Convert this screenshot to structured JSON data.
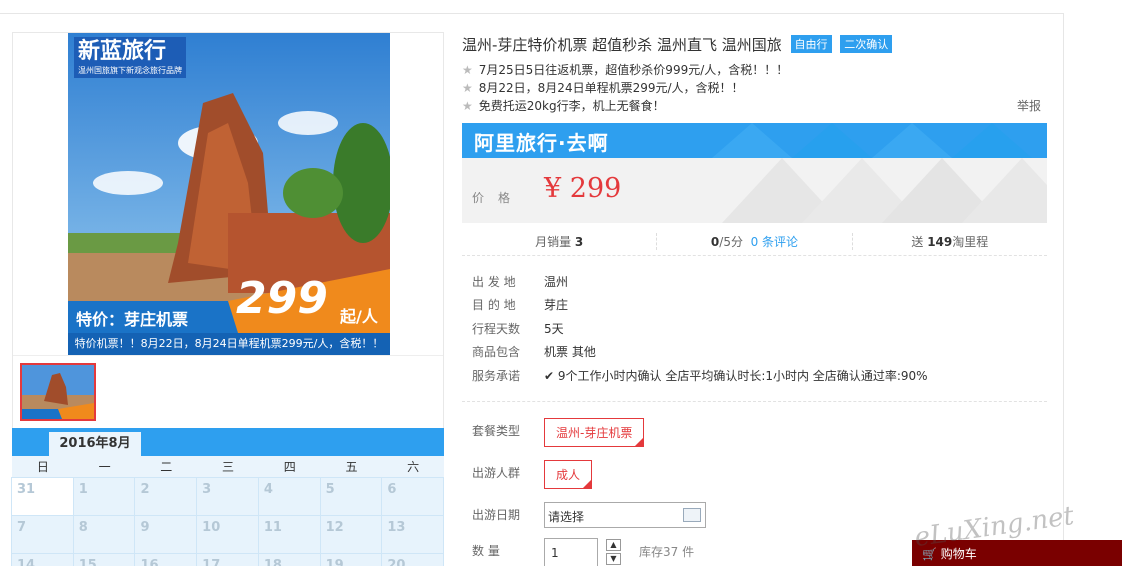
{
  "product": {
    "title": "温州-芽庄特价机票 超值秒杀 温州直飞 温州国旅",
    "tags": [
      "自由行",
      "二次确认"
    ],
    "features": [
      "7月25日5日往返机票，超值秒杀价999元/人，含税！！！",
      "8月22日，8月24日单程机票299元/人，含税！！",
      "免费托运20kg行李，机上无餐食！"
    ],
    "report_label": "举报"
  },
  "image": {
    "logo_text": "新蓝旅行",
    "logo_sub": "温州国旅旗下新观念旅行品牌",
    "promo_label": "特价：芽庄机票",
    "promo_price": "299",
    "promo_unit": "起/人",
    "caption": "特价机票！！8月22日，8月24日单程机票299元/人，含税！！"
  },
  "banner": {
    "brand": "阿里旅行·去啊",
    "price_label": "价格",
    "price": "¥ 299"
  },
  "stats": {
    "monthly_sales_label": "月销量",
    "monthly_sales": "3",
    "rating": "0",
    "rating_suffix": "/5分",
    "reviews": "0 条评论",
    "points_prefix": "送",
    "points": "149",
    "points_suffix": "淘里程"
  },
  "info": [
    {
      "label": "出 发 地",
      "value": "温州"
    },
    {
      "label": "目 的 地",
      "value": "芽庄"
    },
    {
      "label": "行程天数",
      "value": "5天"
    },
    {
      "label": "商品包含",
      "value": "机票  其他"
    },
    {
      "label": "服务承诺",
      "value": "✔ 9个工作小时内确认    全店平均确认时长:1小时内    全店确认通过率:90%"
    }
  ],
  "options": {
    "package_label": "套餐类型",
    "package_value": "温州-芽庄机票",
    "people_label": "出游人群",
    "people_value": "成人",
    "date_label": "出游日期",
    "date_placeholder": "请选择",
    "qty_label": "数   量",
    "qty_value": "1",
    "stock": "库存37 件"
  },
  "calendar": {
    "month": "2016年8月",
    "weekdays": [
      "日",
      "一",
      "二",
      "三",
      "四",
      "五",
      "六"
    ],
    "rows": [
      [
        "31",
        "1",
        "2",
        "3",
        "4",
        "5",
        "6"
      ],
      [
        "7",
        "8",
        "9",
        "10",
        "11",
        "12",
        "13"
      ],
      [
        "14",
        "15",
        "16",
        "17",
        "18",
        "19",
        "20"
      ]
    ]
  },
  "cart": {
    "label": "购物车"
  },
  "watermark": "eLuXing.net",
  "colors": {
    "accent": "#2e9fef",
    "price": "#e4393c",
    "cart": "#7a0000"
  }
}
